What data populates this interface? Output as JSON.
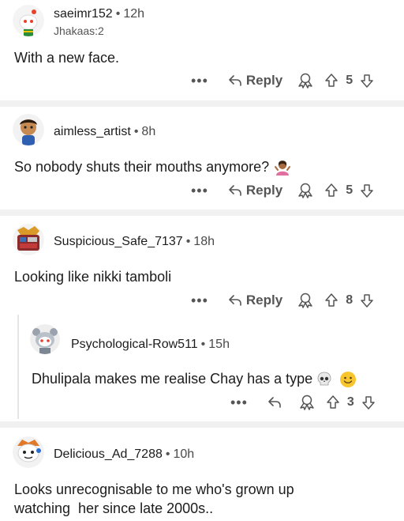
{
  "comments": [
    {
      "username": "saeimr152",
      "time": "12h",
      "flair": "Jhakaas:2",
      "body": "With a new face.",
      "reply_label": "Reply",
      "score": "5"
    },
    {
      "username": "aimless_artist",
      "time": "8h",
      "body": "So nobody shuts their mouths anymore?",
      "reply_label": "Reply",
      "score": "5",
      "emoji": "person-shrugging-emoji"
    },
    {
      "username": "Suspicious_Safe_7137",
      "time": "18h",
      "body": "Looking like nikki tamboli",
      "reply_label": "Reply",
      "score": "8"
    },
    {
      "username": "Psychological-Row511",
      "time": "15h",
      "body": "Dhulipala makes me realise Chay has a type",
      "score": "3",
      "emojis": [
        "skull-emoji",
        "slightly-smiling-face-emoji"
      ]
    },
    {
      "username": "Delicious_Ad_7288",
      "time": "10h",
      "body_line1": "Looks unrecognisable to me who's grown up",
      "body_line2": "watching  her since late 2000s.."
    }
  ],
  "more_label": "•••",
  "dot": "•",
  "colors": {
    "separator": "#f1f1f1",
    "muted": "#555555",
    "text": "#1c1c1c"
  }
}
